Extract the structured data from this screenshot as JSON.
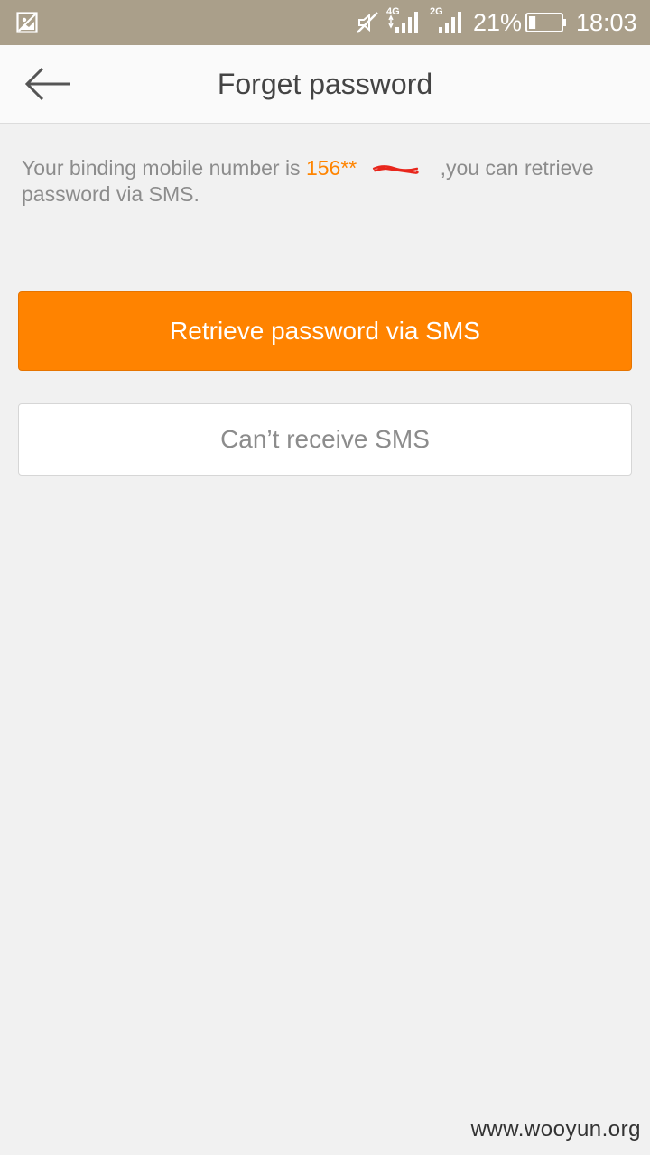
{
  "status_bar": {
    "network_1": "4G",
    "network_2": "2G",
    "battery_percent": "21%",
    "battery_level": 0.21,
    "time": "18:03",
    "icons": [
      "image-icon",
      "mute-icon",
      "signal-icon",
      "signal-icon",
      "battery-icon"
    ],
    "background_color": "#aa9f8a"
  },
  "header": {
    "title": "Forget password",
    "back_icon": "arrow-left-icon"
  },
  "info": {
    "prefix": "Your binding mobile number is ",
    "phone_visible": "156**",
    "suffix": " ,you can retrieve password via SMS."
  },
  "buttons": {
    "primary_label": "Retrieve password via SMS",
    "secondary_label": "Can’t receive SMS"
  },
  "colors": {
    "accent": "#ff8300",
    "background": "#f1f1f1",
    "text_muted": "#8c8c8c"
  },
  "watermark": "www.wooyun.org"
}
